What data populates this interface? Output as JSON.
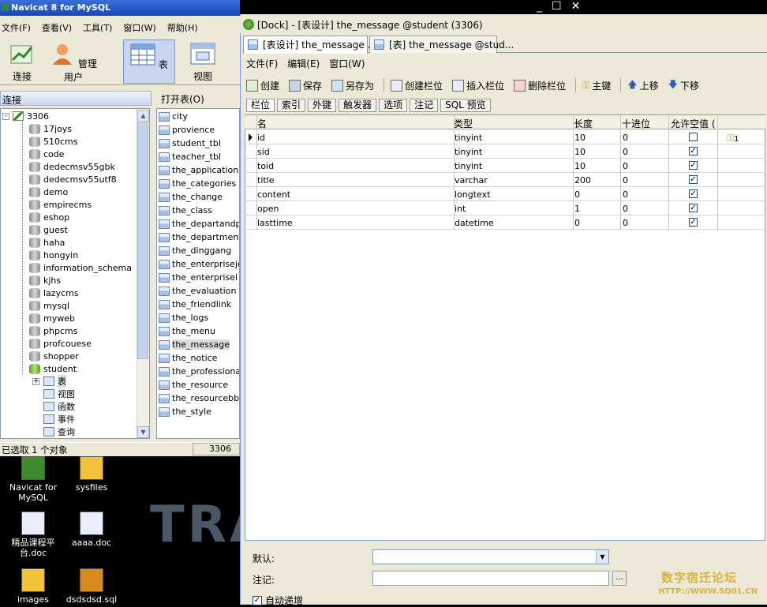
{
  "back_window": {
    "title": "Navicat 8 for MySQL",
    "menu": [
      "文件(F)",
      "查看(V)",
      "工具(T)",
      "窗口(W)",
      "帮助(H)"
    ],
    "tools": {
      "connect": "连接",
      "manage_users": "管理用户",
      "table": "表",
      "view": "视图"
    },
    "connection_header": "连接",
    "open_table_label": "打开表(O)",
    "connection_name": "3306",
    "databases": [
      "17joys",
      "510cms",
      "code",
      "dedecmsv55gbk",
      "dedecmsv55utf8",
      "demo",
      "empirecms",
      "eshop",
      "guest",
      "haha",
      "hongyin",
      "information_schema",
      "kjhs",
      "lazycms",
      "mysql",
      "myweb",
      "phpcms",
      "profcouese",
      "shopper",
      "student"
    ],
    "student_children": [
      "表",
      "视图",
      "函数",
      "事件",
      "查询"
    ],
    "tables": [
      "city",
      "provience",
      "student_tbl",
      "teacher_tbl",
      "the_application",
      "the_categories",
      "the_change",
      "the_class",
      "the_departandpr",
      "the_departments",
      "the_dinggang",
      "the_enterprisejob",
      "the_enterprisel",
      "the_evaluation",
      "the_friendlink",
      "the_logs",
      "the_menu",
      "the_message",
      "the_notice",
      "the_professional",
      "the_resource",
      "the_resourcebbs",
      "the_style"
    ],
    "selected_table": "the_message",
    "status": "已选取 1 个对象",
    "status_connection": "3306"
  },
  "desktop": {
    "icons": [
      {
        "label": "Navicat for MySQL",
        "icon": "navicat-icon"
      },
      {
        "label": "sysfiles",
        "icon": "folder-icon"
      },
      {
        "label": "精品课程平台.doc",
        "icon": "word-doc-icon"
      },
      {
        "label": "aaaa.doc",
        "icon": "word-doc-icon"
      },
      {
        "label": "images",
        "icon": "folder-icon"
      },
      {
        "label": "dsdsdsd.sql",
        "icon": "sql-file-icon"
      }
    ],
    "wallpaper_text": "TRA"
  },
  "designer": {
    "title": "[Dock] - [表设计] the_message @student (3306)",
    "tabs": [
      "[表设计] the_message ...",
      "[表] the_message @stud..."
    ],
    "menu": [
      "文件(F)",
      "编辑(E)",
      "窗口(W)"
    ],
    "toolbar": [
      "创建",
      "保存",
      "另存为",
      "创建栏位",
      "插入栏位",
      "删除栏位",
      "主键",
      "上移",
      "下移"
    ],
    "subtabs": [
      "栏位",
      "索引",
      "外键",
      "触发器",
      "选项",
      "注记",
      "SQL 预览"
    ],
    "columns": [
      "名",
      "类型",
      "长度",
      "十进位",
      "允许空值 (",
      ""
    ],
    "rows": [
      {
        "name": "id",
        "type": "tinyint",
        "length": "10",
        "decimals": "0",
        "nullable": false,
        "key": "1"
      },
      {
        "name": "sid",
        "type": "tinyint",
        "length": "10",
        "decimals": "0",
        "nullable": true,
        "key": ""
      },
      {
        "name": "toid",
        "type": "tinyint",
        "length": "10",
        "decimals": "0",
        "nullable": true,
        "key": ""
      },
      {
        "name": "title",
        "type": "varchar",
        "length": "200",
        "decimals": "0",
        "nullable": true,
        "key": ""
      },
      {
        "name": "content",
        "type": "longtext",
        "length": "0",
        "decimals": "0",
        "nullable": true,
        "key": ""
      },
      {
        "name": "open",
        "type": "int",
        "length": "1",
        "decimals": "0",
        "nullable": true,
        "key": ""
      },
      {
        "name": "lasttime",
        "type": "datetime",
        "length": "0",
        "decimals": "0",
        "nullable": true,
        "key": ""
      }
    ],
    "default_label": "默认:",
    "comment_label": "注记:",
    "auto_increment_label": "自动递增",
    "auto_increment": true,
    "browse_button": "..."
  },
  "watermark": {
    "line1": "数字宿迁论坛",
    "line2": "HTTP://WWW.SQ01.CN"
  }
}
